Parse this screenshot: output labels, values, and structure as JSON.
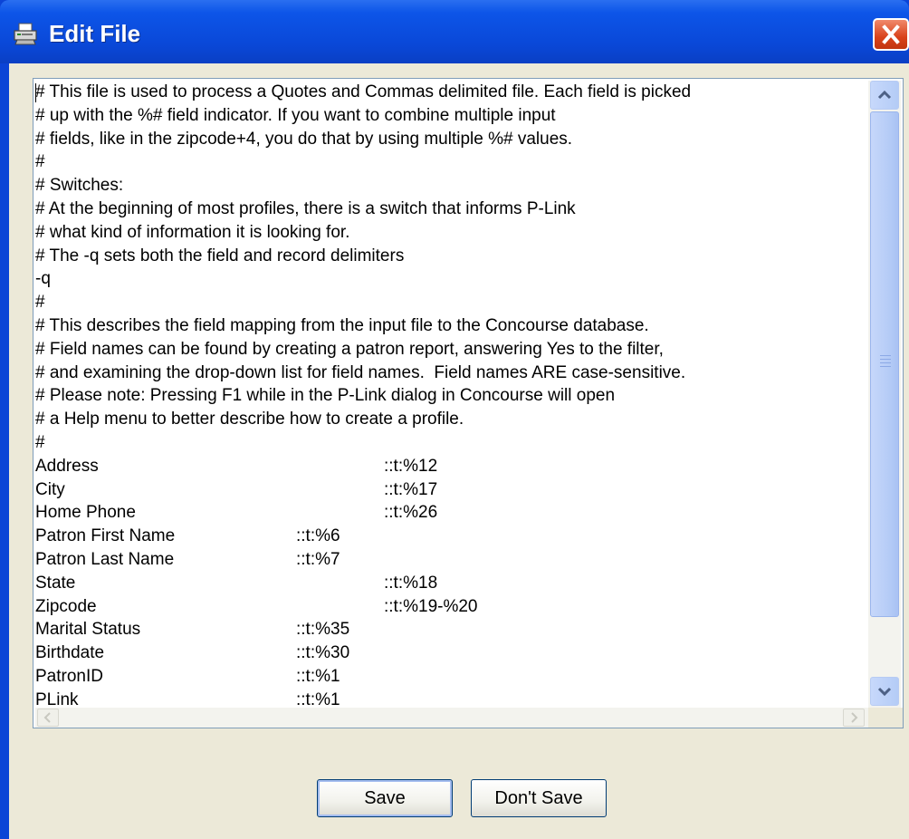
{
  "window": {
    "title": "Edit File",
    "icon": "printer-icon",
    "close_icon": "close-icon",
    "title_gradient": "#0a48d8",
    "close_color": "#d9411a"
  },
  "editor": {
    "lines": [
      "# This file is used to process a Quotes and Commas delimited file. Each field is picked",
      "# up with the %# field indicator. If you want to combine multiple input",
      "# fields, like in the zipcode+4, you do that by using multiple %# values.",
      "#",
      "# Switches:",
      "# At the beginning of most profiles, there is a switch that informs P-Link",
      "# what kind of information it is looking for.",
      "# The -q sets both the field and record delimiters",
      "-q",
      "#",
      "# This describes the field mapping from the input file to the Concourse database.",
      "# Field names can be found by creating a patron report, answering Yes to the filter,",
      "# and examining the drop-down list for field names.  Field names ARE case-sensitive.",
      "# Please note: Pressing F1 while in the P-Link dialog in Concourse will open",
      "# a Help menu to better describe how to create a profile.",
      "#"
    ],
    "mappings": [
      {
        "field": "Address",
        "code": "::t:%12",
        "indent": "wide"
      },
      {
        "field": "City",
        "code": "::t:%17",
        "indent": "wide"
      },
      {
        "field": "Home Phone",
        "code": "::t:%26",
        "indent": "wide"
      },
      {
        "field": "Patron First Name",
        "code": "::t:%6",
        "indent": "narrow"
      },
      {
        "field": "Patron Last Name",
        "code": "::t:%7",
        "indent": "narrow"
      },
      {
        "field": "State",
        "code": "::t:%18",
        "indent": "wide"
      },
      {
        "field": "Zipcode",
        "code": "::t:%19-%20",
        "indent": "wide"
      },
      {
        "field": "Marital Status",
        "code": "::t:%35",
        "indent": "narrow"
      },
      {
        "field": "Birthdate",
        "code": "::t:%30",
        "indent": "narrow"
      },
      {
        "field": "PatronID",
        "code": "::t:%1",
        "indent": "narrow"
      },
      {
        "field": "PLink",
        "code": "::t:%1",
        "indent": "narrow"
      }
    ]
  },
  "buttons": {
    "save": "Save",
    "dont_save": "Don't Save"
  }
}
